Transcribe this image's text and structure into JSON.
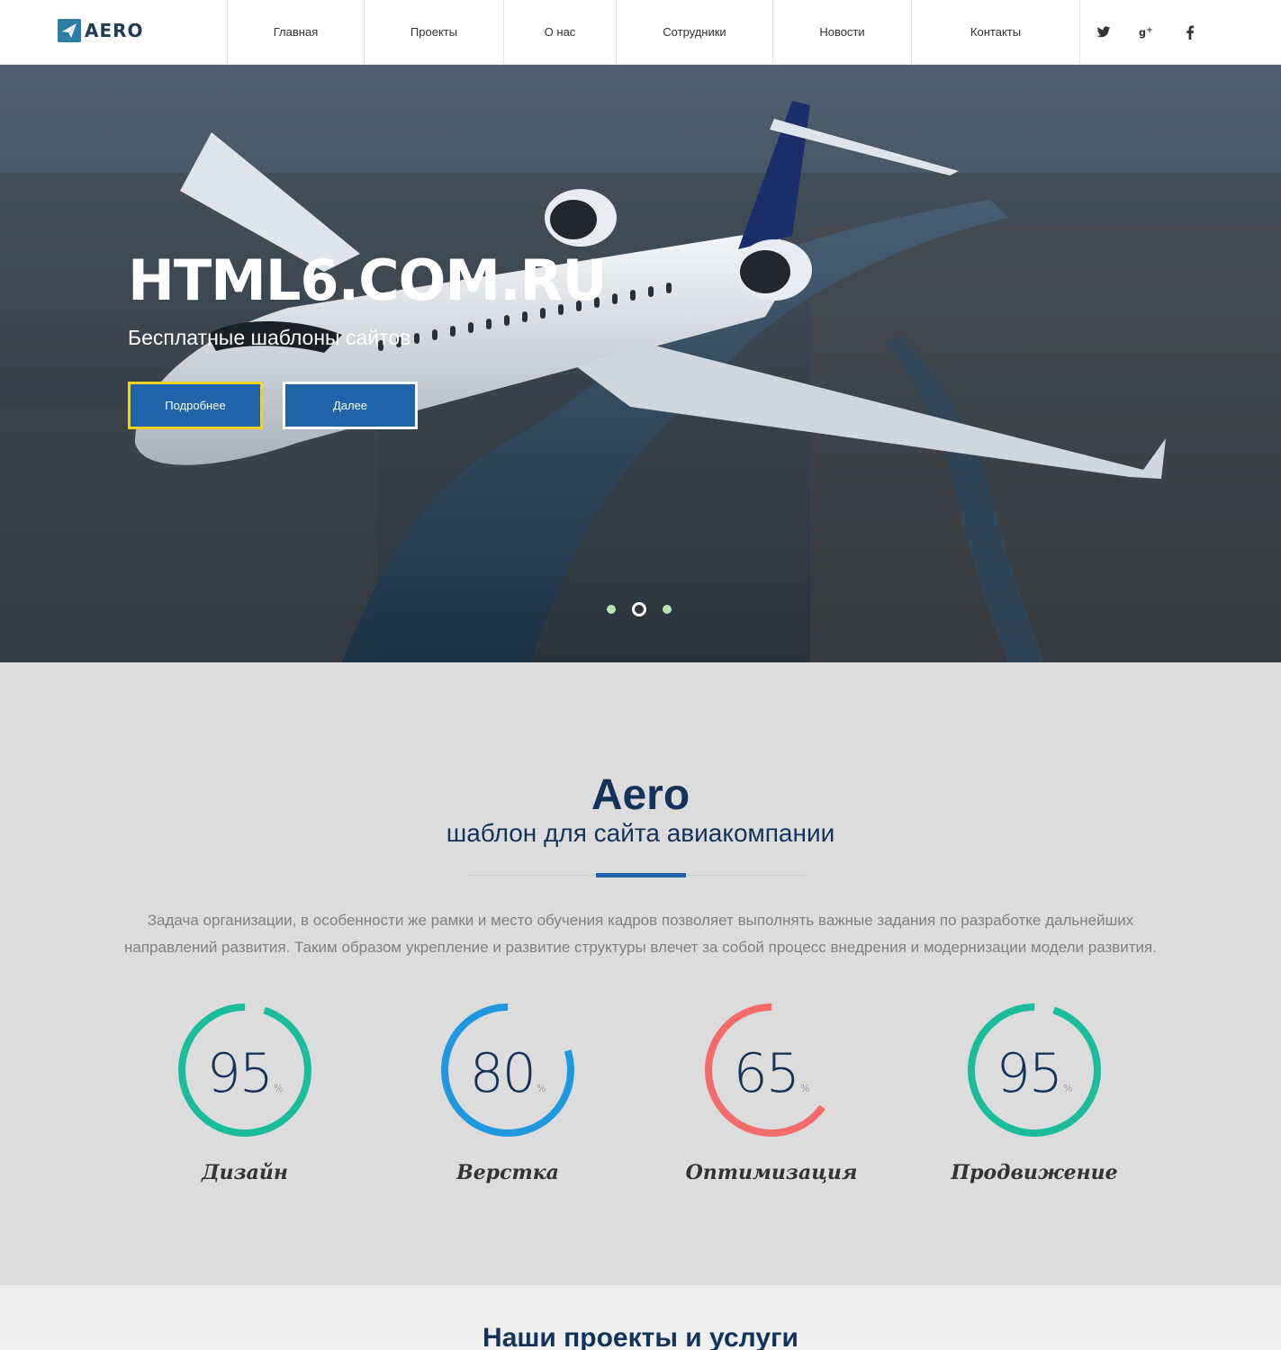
{
  "brand": {
    "logo_text": "AERO"
  },
  "nav": {
    "items": [
      {
        "label": "Главная"
      },
      {
        "label": "Проекты"
      },
      {
        "label": "О нас"
      },
      {
        "label": "Сотрудники"
      },
      {
        "label": "Новости"
      },
      {
        "label": "Контакты"
      }
    ]
  },
  "social": [
    "twitter-icon",
    "google-plus-icon",
    "facebook-icon"
  ],
  "hero": {
    "title": "HTML6.COM.RU",
    "subtitle": "Бесплатные шаблоны сайтов",
    "btn_more": "Подробнее",
    "btn_next": "Далее",
    "slides": 3,
    "active_slide": 2
  },
  "about": {
    "title": "Aero",
    "subtitle": "шаблон для сайта авиакомпании",
    "text": "Задача организации, в особенности же рамки и место обучения кадров позволяет выполнять важные задания по разработке дальнейших направлений развития. Таким образом укрепление и развитие структуры влечет за собой процесс внедрения и модернизации модели развития."
  },
  "stats": [
    {
      "value": "95",
      "unit": "%",
      "label": "Дизайн",
      "color": "#1abc9c",
      "percent": 95
    },
    {
      "value": "80",
      "unit": "%",
      "label": "Верстка",
      "color": "#1f98e0",
      "percent": 80
    },
    {
      "value": "65",
      "unit": "%",
      "label": "Оптимизация",
      "color": "#f36b6b",
      "percent": 65
    },
    {
      "value": "95",
      "unit": "%",
      "label": "Продвижение",
      "color": "#1abc9c",
      "percent": 95
    }
  ],
  "services": {
    "title": "Наши проекты и услуги"
  },
  "colors": {
    "accent": "#1f64a8",
    "heading": "#14335a",
    "btn_border_highlight": "#f4d21f"
  }
}
